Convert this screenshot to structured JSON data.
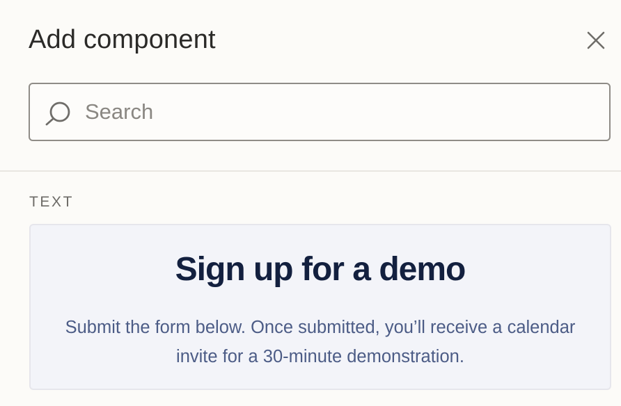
{
  "panel": {
    "title": "Add component",
    "close_icon": "close-icon"
  },
  "search": {
    "placeholder": "Search",
    "value": "",
    "icon": "search-icon"
  },
  "sections": [
    {
      "label": "TEXT",
      "items": [
        {
          "heading": "Sign up for a demo",
          "body": "Submit the form below. Once submitted, you’ll receive a calendar invite for a 30-minute demonstration."
        }
      ]
    }
  ],
  "colors": {
    "background": "#fcfbf8",
    "card_background": "#f3f4f9",
    "card_heading": "#13203f",
    "card_body": "#4c5c86",
    "search_border": "#8f8c87"
  }
}
